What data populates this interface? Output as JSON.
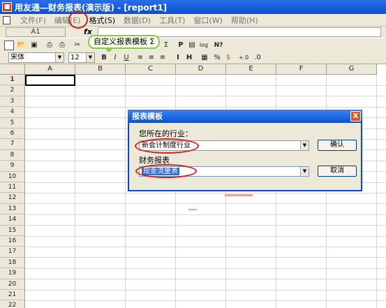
{
  "window": {
    "title": "用友通—财务报表(演示版) - [report1]"
  },
  "menu": {
    "items": [
      "文件(F)",
      "编辑(E)",
      "格式(S)",
      "数据(D)",
      "工具(T)",
      "窗口(W)",
      "帮助(H)"
    ]
  },
  "formula_bar": {
    "cell_ref": "A1",
    "fx_label": "fx"
  },
  "toolbar": {
    "tooltip": "自定义报表模板",
    "sigma_label": "Σ",
    "p_label": "P",
    "log_label": "log",
    "help_label": "N?",
    "font_name": "宋体",
    "font_size": "12",
    "bold_label": "B",
    "italic_label": "I",
    "underline_label": "U",
    "percent_label": "%",
    "dollar_label": "$",
    "decimal_label": "+.0"
  },
  "grid": {
    "columns": [
      "A",
      "B",
      "C",
      "D",
      "E",
      "F",
      "G"
    ],
    "rows": [
      "1",
      "2",
      "3",
      "4",
      "5",
      "6",
      "7",
      "8",
      "9",
      "10",
      "11",
      "12",
      "13",
      "14",
      "15",
      "16",
      "17",
      "18",
      "19",
      "20",
      "21",
      "22"
    ]
  },
  "dialog": {
    "title": "报表模板",
    "close_label": "X",
    "industry_label": "您所在的行业：",
    "industry_value": "新会计制度行业",
    "report_label": "财务报表",
    "report_value": "现金流量表",
    "confirm_label": "确认",
    "cancel_label": "取消"
  }
}
